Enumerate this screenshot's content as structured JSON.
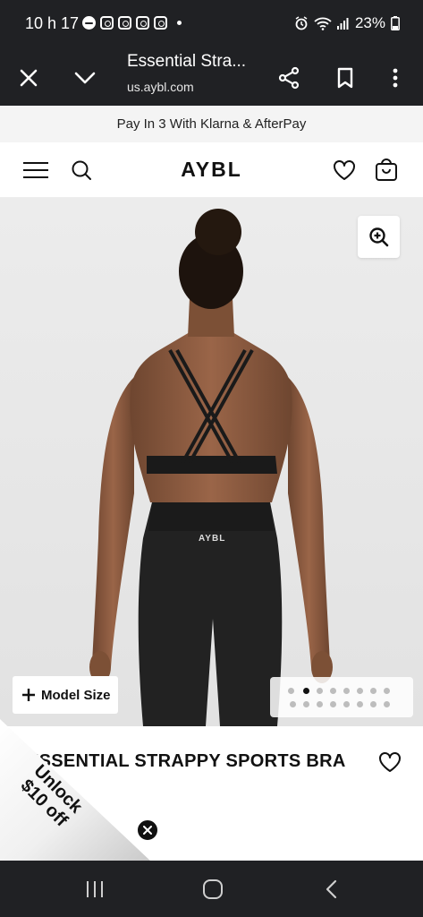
{
  "status_bar": {
    "time": "10 h 17",
    "battery": "23%"
  },
  "browser": {
    "page_title": "Essential Stra...",
    "url": "us.aybl.com"
  },
  "promo_banner": {
    "text": "Pay In 3 With Klarna & AfterPay"
  },
  "site_header": {
    "logo": "AYBL"
  },
  "product_image": {
    "waistband_logo": "AYBL",
    "model_size_label": "Model Size",
    "pager": {
      "total": 16,
      "current": 3
    }
  },
  "product": {
    "title": "ESSENTIAL STRAPPY SPORTS BRA"
  },
  "unlock_promo": {
    "line1": "Unlock",
    "line2": "$10 off"
  },
  "colors": {
    "system_bar": "#202124",
    "promo_bg": "#f4f4f4",
    "image_bg": "#e9e9e9",
    "text_dark": "#111111"
  }
}
